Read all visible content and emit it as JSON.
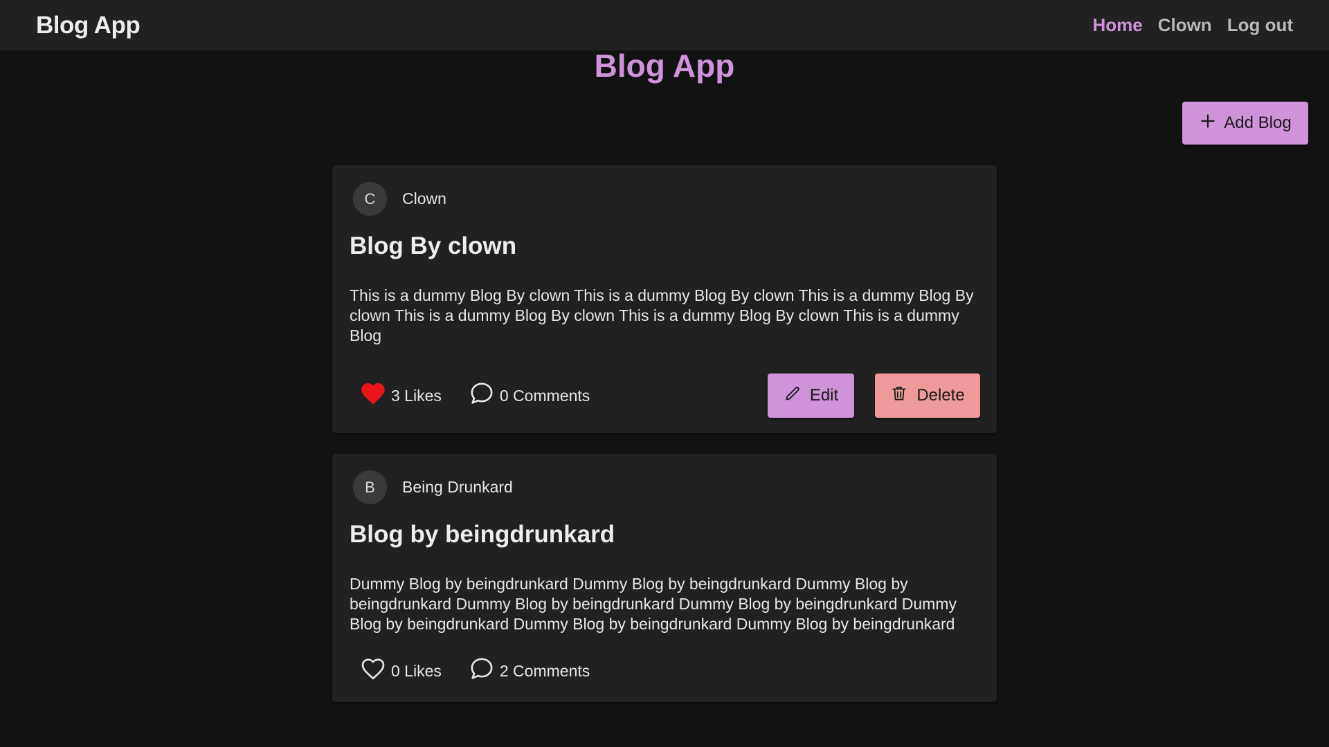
{
  "nav": {
    "brand": "Blog App",
    "links": [
      {
        "label": "Home",
        "active": true
      },
      {
        "label": "Clown",
        "active": false
      },
      {
        "label": "Log out",
        "active": false
      }
    ]
  },
  "page": {
    "title": "Blog App",
    "add_button_label": "Add Blog"
  },
  "posts": [
    {
      "author_initial": "C",
      "author_name": "Clown",
      "title": "Blog By clown",
      "body": "This is a dummy Blog By clown This is a dummy Blog By clown This is a dummy Blog By clown This is a dummy Blog By clown This is a dummy Blog By clown This is a dummy Blog",
      "likes": "3 Likes",
      "liked": true,
      "comments": "0 Comments",
      "edit_label": "Edit",
      "delete_label": "Delete"
    },
    {
      "author_initial": "B",
      "author_name": "Being Drunkard",
      "title": "Blog by beingdrunkard",
      "body": "Dummy Blog by beingdrunkard Dummy Blog by beingdrunkard Dummy Blog by beingdrunkard Dummy Blog by beingdrunkard Dummy Blog by beingdrunkard Dummy Blog by beingdrunkard Dummy Blog by beingdrunkard Dummy Blog by beingdrunkard",
      "likes": "0 Likes",
      "liked": false,
      "comments": "2 Comments"
    }
  ],
  "colors": {
    "accent": "#ce93d8",
    "danger": "#ef9a9a",
    "like_active": "#e8161b",
    "navbar_bg": "#212121",
    "page_bg": "#121212",
    "card_bg": "#212121"
  },
  "icons": {
    "add": "plus-icon",
    "edit": "pencil-icon",
    "delete": "trash-icon",
    "like": "heart-icon",
    "comment": "comment-bubble-icon"
  }
}
